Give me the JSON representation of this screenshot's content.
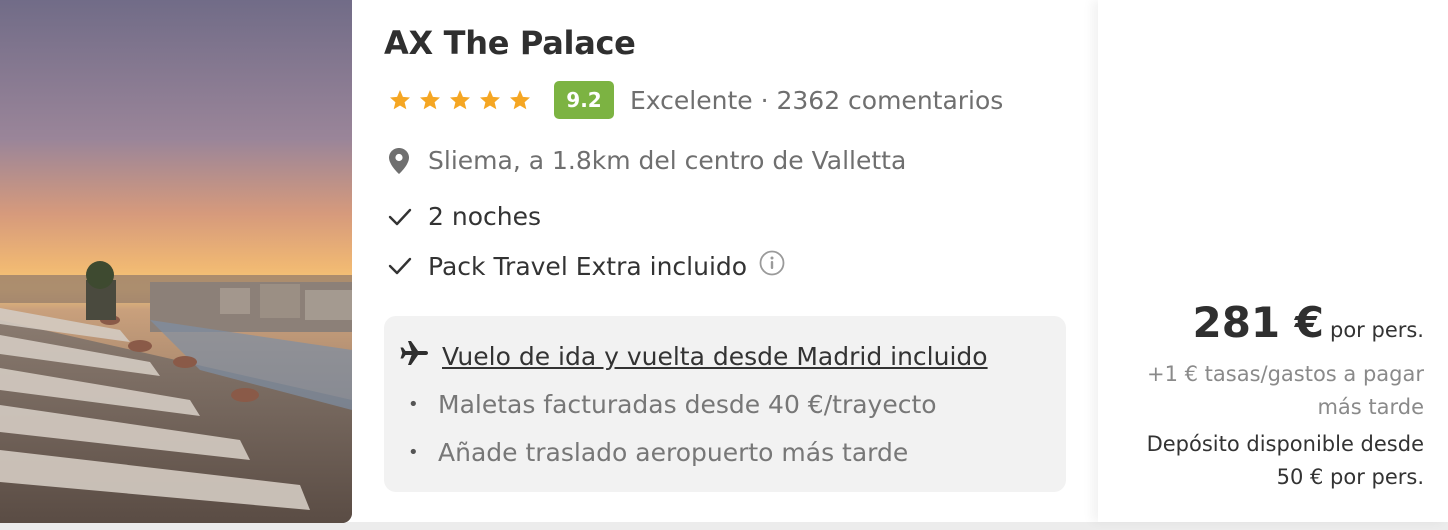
{
  "hotel": {
    "name": "AX The Palace",
    "stars": 5,
    "score": "9.2",
    "rating_text": "Excelente · 2362 comentarios",
    "location": "Sliema, a 1.8km del centro de Valletta",
    "features": [
      "2 noches",
      "Pack Travel Extra incluido"
    ]
  },
  "flight": {
    "label": "Vuelo de ida y vuelta desde Madrid incluido",
    "bullets": [
      "Maletas facturadas desde 40 €/trayecto",
      "Añade traslado aeropuerto más tarde"
    ]
  },
  "price": {
    "amount": "281 €",
    "per": "por pers.",
    "tax_line1": "+1 € tasas/gastos a pagar",
    "tax_line2": "más tarde",
    "deposit_line1": "Depósito disponible desde",
    "deposit_line2": "50 € por pers."
  },
  "colors": {
    "star": "#f5a623",
    "score_bg": "#7cb342",
    "flight_box_bg": "#f2f2f2"
  },
  "icons": [
    "star-icon",
    "location-pin-icon",
    "check-icon",
    "info-icon",
    "airplane-icon"
  ]
}
